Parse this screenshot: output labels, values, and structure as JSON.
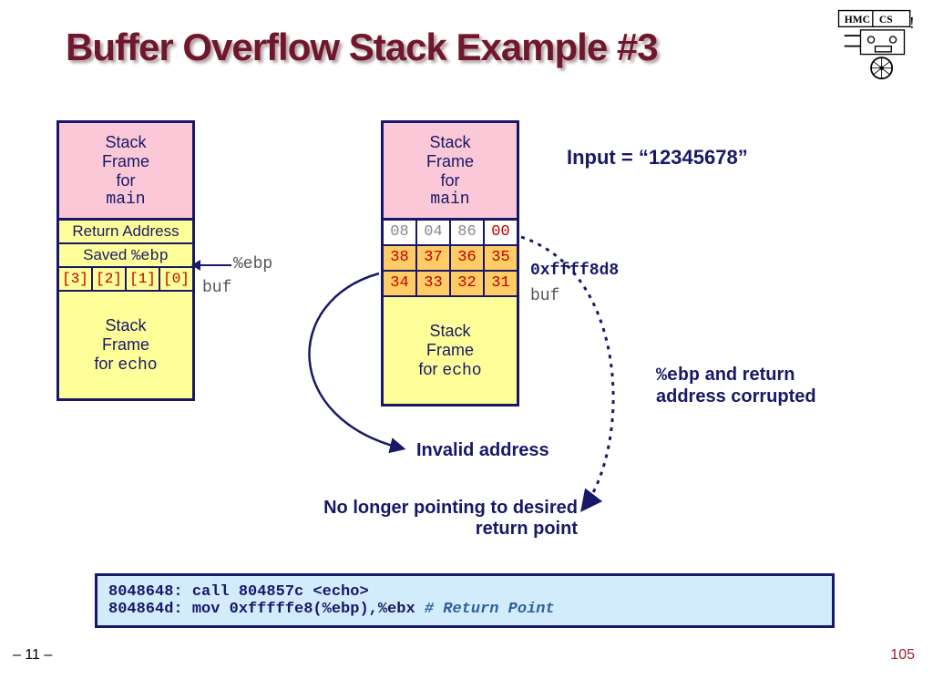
{
  "title": "Buffer Overflow Stack Example #3",
  "stack1": {
    "frame_main_l1": "Stack",
    "frame_main_l2": "Frame",
    "frame_main_l3_prefix": "for ",
    "frame_main_l3_mono": "main",
    "return_addr": "Return Address",
    "saved_prefix": "Saved ",
    "saved_mono": "%ebp",
    "buf": [
      "[3]",
      "[2]",
      "[1]",
      "[0]"
    ],
    "frame_echo_l1": "Stack",
    "frame_echo_l2": "Frame",
    "frame_echo_l3_prefix": "for ",
    "frame_echo_l3_mono": "echo"
  },
  "ebp_label": "%ebp",
  "buf_label": "buf",
  "stack2": {
    "frame_main_l1": "Stack",
    "frame_main_l2": "Frame",
    "frame_main_l3_prefix": "for ",
    "frame_main_l3_mono": "main",
    "row1": [
      "08",
      "04",
      "86",
      "00"
    ],
    "row2": [
      "38",
      "37",
      "36",
      "35"
    ],
    "row3": [
      "34",
      "33",
      "32",
      "31"
    ],
    "frame_echo_l1": "Stack",
    "frame_echo_l2": "Frame",
    "frame_echo_l3_prefix": "for ",
    "frame_echo_l3_mono": "echo"
  },
  "hex_label": "0xffff8d8",
  "input_label": "Input = “12345678”",
  "corrupted_prefix": "%ebp",
  "corrupted_rest": " and return address corrupted",
  "invalid_label": "Invalid address",
  "nolonger_label": "No longer pointing to desired return point",
  "code_line1": "8048648:  call 804857c <echo>",
  "code_line2_a": "804864d:  mov  0xfffffe8(%ebp),%ebx ",
  "code_line2_b": "# Return Point",
  "page_num": "105",
  "page_ref": "– 11 –"
}
